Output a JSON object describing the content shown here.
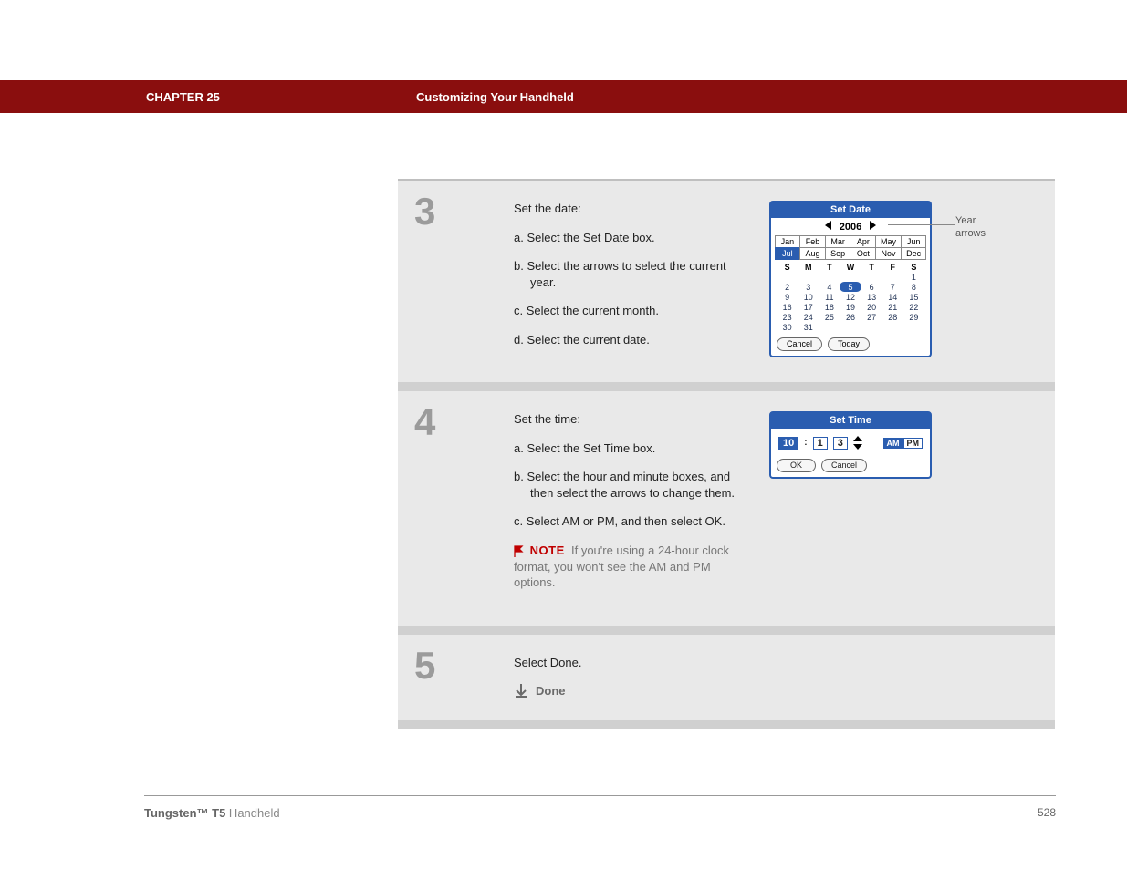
{
  "header": {
    "chapter": "CHAPTER 25",
    "title": "Customizing Your Handheld"
  },
  "steps": {
    "s3": {
      "num": "3",
      "intro": "Set the date:",
      "a": "a.  Select the Set Date box.",
      "b": "b.  Select the arrows to select the current year.",
      "c": "c.  Select the current month.",
      "d": "d.  Select the current date."
    },
    "s4": {
      "num": "4",
      "intro": "Set the time:",
      "a": "a.  Select the Set Time box.",
      "b": "b.  Select the hour and minute boxes, and then select the arrows to change them.",
      "c": "c.  Select AM or PM, and then select OK.",
      "note_label": "NOTE",
      "note_body": "If you're using a 24-hour clock format, you won't see the AM and PM options."
    },
    "s5": {
      "num": "5",
      "text": "Select Done.",
      "done": "Done"
    }
  },
  "setdate": {
    "title": "Set Date",
    "year": "2006",
    "year_callout": "Year arrows",
    "months": [
      "Jan",
      "Feb",
      "Mar",
      "Apr",
      "May",
      "Jun",
      "Jul",
      "Aug",
      "Sep",
      "Oct",
      "Nov",
      "Dec"
    ],
    "selected_month_index": 6,
    "dow": [
      "S",
      "M",
      "T",
      "W",
      "T",
      "F",
      "S"
    ],
    "days": [
      "",
      "",
      "",
      "",
      "",
      "",
      "1",
      "2",
      "3",
      "4",
      "5",
      "6",
      "7",
      "8",
      "9",
      "10",
      "11",
      "12",
      "13",
      "14",
      "15",
      "16",
      "17",
      "18",
      "19",
      "20",
      "21",
      "22",
      "23",
      "24",
      "25",
      "26",
      "27",
      "28",
      "29",
      "30",
      "31",
      "",
      "",
      "",
      "",
      ""
    ],
    "selected_day": "5",
    "btn_cancel": "Cancel",
    "btn_today": "Today"
  },
  "settime": {
    "title": "Set Time",
    "hour": "10",
    "m1": "1",
    "m2": "3",
    "am": "AM",
    "pm": "PM",
    "btn_ok": "OK",
    "btn_cancel": "Cancel"
  },
  "footer": {
    "product_bold": "Tungsten™ T5",
    "product_rest": " Handheld",
    "page": "528"
  }
}
